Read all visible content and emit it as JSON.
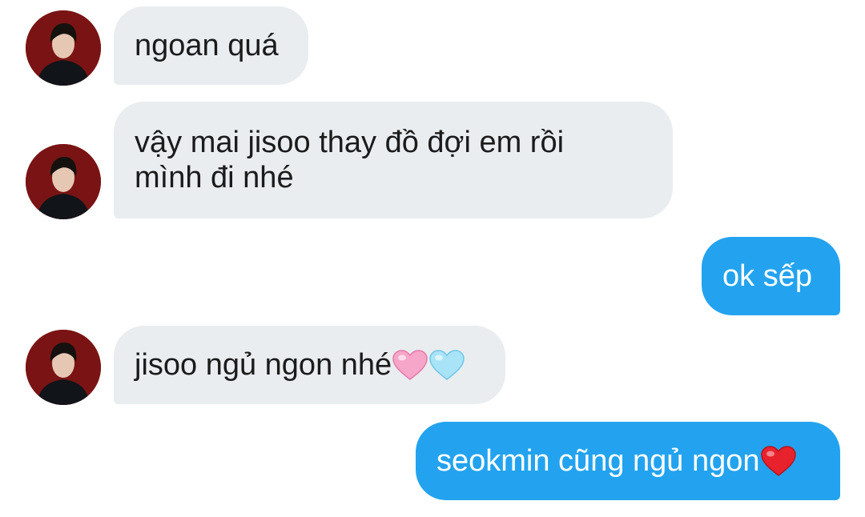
{
  "conversation": {
    "messages": [
      {
        "direction": "incoming",
        "text": "ngoan quá",
        "has_avatar": true
      },
      {
        "direction": "incoming",
        "text": "vậy mai jisoo thay đồ đợi em rồi\nmình đi nhé",
        "has_avatar": true
      },
      {
        "direction": "outgoing",
        "text": "ok sếp"
      },
      {
        "direction": "incoming",
        "text": "jisoo ngủ ngon nhé",
        "emojis": [
          "pink-heart-emoji",
          "light-blue-heart-emoji"
        ],
        "has_avatar": true
      },
      {
        "direction": "outgoing",
        "text": "seokmin cũng ngủ ngon",
        "emojis": [
          "red-heart-emoji"
        ]
      }
    ]
  },
  "colors": {
    "incoming_bubble": "#e9edf0",
    "outgoing_bubble": "#23a3ef",
    "incoming_text": "#1b1b1b",
    "outgoing_text": "#ffffff",
    "avatar_background": "#7a1414"
  }
}
